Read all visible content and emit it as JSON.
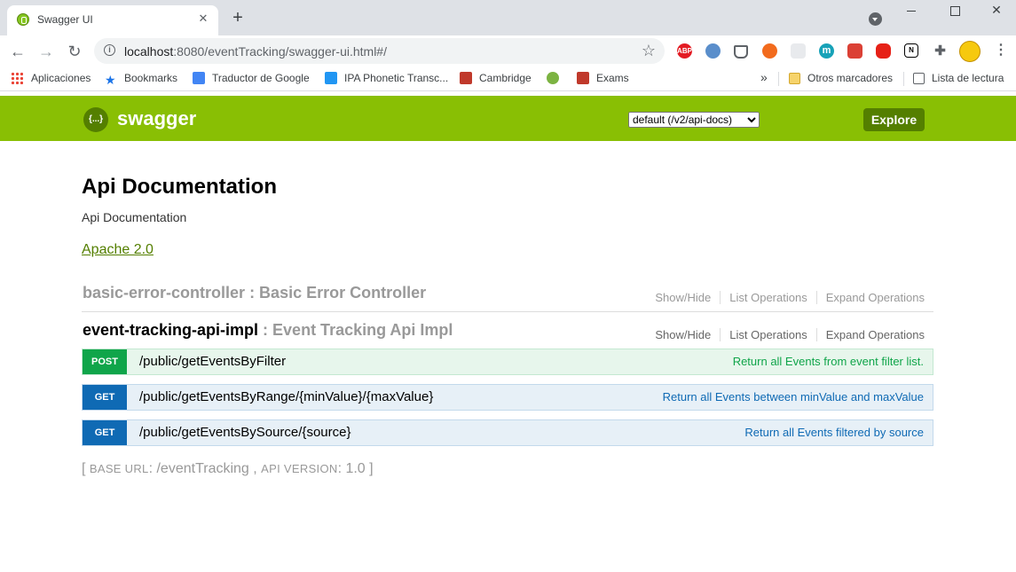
{
  "browser": {
    "tab_title": "Swagger UI",
    "tab_close": "✕",
    "new_tab": "+",
    "url_host": "localhost",
    "url_rest": ":8080/eventTracking/swagger-ui.html#/",
    "extensions": [
      "ABP",
      "m"
    ],
    "bookmarks": [
      {
        "label": "Aplicaciones",
        "icon": "apps-grid-icon"
      },
      {
        "label": "Bookmarks",
        "icon": "star-icon"
      },
      {
        "label": "Traductor de Google",
        "icon": "google-translate-icon"
      },
      {
        "label": "IPA Phonetic Transc...",
        "icon": "ipa-icon"
      },
      {
        "label": "Cambridge",
        "icon": "cambridge-shield-icon"
      },
      {
        "label": "",
        "icon": "people-icon"
      },
      {
        "label": "Exams",
        "icon": "cambridge-shield-icon"
      }
    ],
    "bookmarks_overflow": "»",
    "other_bookmarks": "Otros marcadores",
    "reading_list": "Lista de lectura",
    "colors": {
      "tabstrip": "#dee1e6",
      "omnibox": "#f1f3f4"
    }
  },
  "swagger": {
    "header": {
      "logo_glyph": "{...}",
      "title": "swagger",
      "spec_select": "default (/v2/api-docs)",
      "explore_label": "Explore",
      "color": "#89bf04"
    },
    "info": {
      "title": "Api Documentation",
      "description": "Api Documentation",
      "license": "Apache 2.0"
    },
    "resources": [
      {
        "name": "basic-error-controller",
        "description": " : Basic Error Controller",
        "ops": [
          "Show/Hide",
          "List Operations",
          "Expand Operations"
        ]
      },
      {
        "name": "event-tracking-api-impl",
        "description": " : Event Tracking Api Impl",
        "ops": [
          "Show/Hide",
          "List Operations",
          "Expand Operations"
        ],
        "operations": [
          {
            "method": "POST",
            "path": "/public/getEventsByFilter",
            "summary": "Return all Events from event filter list."
          },
          {
            "method": "GET",
            "path": "/public/getEventsByRange/{minValue}/{maxValue}",
            "summary": "Return all Events between minValue and maxValue"
          },
          {
            "method": "GET",
            "path": "/public/getEventsBySource/{source}",
            "summary": "Return all Events filtered by source"
          }
        ]
      }
    ],
    "footer": {
      "open": "[ ",
      "base_url_label": "BASE URL",
      "base_url_value": ": /eventTracking , ",
      "api_version_label": "API VERSION",
      "api_version_value": ": 1.0 ]"
    }
  }
}
